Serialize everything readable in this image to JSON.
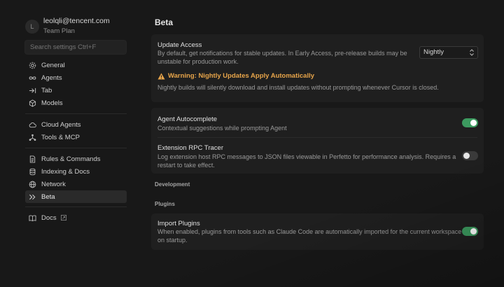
{
  "account": {
    "avatar_initial": "L",
    "email": "leolqli@tencent.com",
    "plan": "Team Plan"
  },
  "sidebar": {
    "search_placeholder": "Search settings Ctrl+F",
    "groups": [
      [
        {
          "label": "General",
          "icon": "gear-icon"
        },
        {
          "label": "Agents",
          "icon": "infinity-icon"
        },
        {
          "label": "Tab",
          "icon": "arrow-right-bar-icon"
        },
        {
          "label": "Models",
          "icon": "cube-icon"
        }
      ],
      [
        {
          "label": "Cloud Agents",
          "icon": "cloud-icon"
        },
        {
          "label": "Tools & MCP",
          "icon": "nodes-icon"
        }
      ],
      [
        {
          "label": "Rules & Commands",
          "icon": "document-icon"
        },
        {
          "label": "Indexing & Docs",
          "icon": "database-icon"
        },
        {
          "label": "Network",
          "icon": "globe-icon"
        },
        {
          "label": "Beta",
          "icon": "double-chevron-icon",
          "active": true
        }
      ],
      [
        {
          "label": "Docs",
          "icon": "book-icon",
          "external": true
        }
      ]
    ]
  },
  "main": {
    "title": "Beta",
    "update_access": {
      "title": "Update Access",
      "desc_line1": "By default, get notifications for stable updates. In Early Access, pre-release builds may be",
      "desc_line2": "unstable for production work.",
      "selected": "Nightly",
      "warning": "Warning: Nightly Updates Apply Automatically",
      "warning_desc": "Nightly builds will silently download and install updates without prompting whenever Cursor is closed."
    },
    "agent_autocomplete": {
      "title": "Agent Autocomplete",
      "desc": "Contextual suggestions while prompting Agent",
      "enabled": true
    },
    "rpc_tracer": {
      "title": "Extension RPC Tracer",
      "desc_line1": "Log extension host RPC messages to JSON files viewable in Perfetto for performance analysis. Requires a",
      "desc_line2": "restart to take effect.",
      "enabled": false
    },
    "section_development": "Development",
    "section_plugins": "Plugins",
    "import_plugins": {
      "title": "Import Plugins",
      "desc_line1": "When enabled, plugins from tools such as Claude Code are automatically imported for the current workspace",
      "desc_line2": "on startup.",
      "enabled": true
    }
  },
  "colors": {
    "background": "#181818",
    "card": "#1f1f1f",
    "toggle_on": "#3c9a5f",
    "warning": "#e8a54a"
  }
}
